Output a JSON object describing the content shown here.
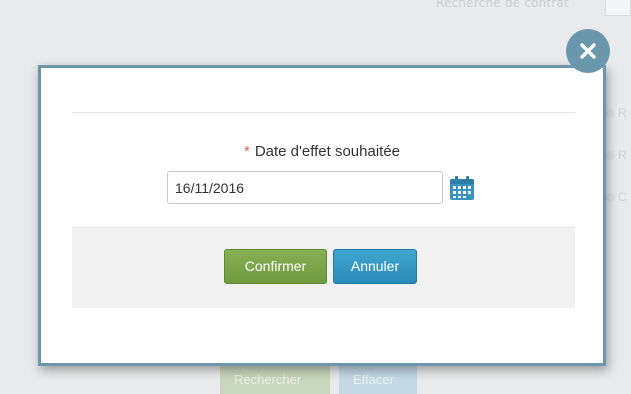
{
  "background": {
    "header_text": "Recherche de contrat",
    "side_labels": [
      "R",
      "R",
      "C"
    ],
    "search_button": "Rechercher",
    "clear_button": "Effacer"
  },
  "modal": {
    "field_label": "Date d'effet souhaitée",
    "required_marker": "*",
    "date_value": "16/11/2016",
    "confirm_label": "Confirmer",
    "cancel_label": "Annuler",
    "close_icon": "close-icon",
    "calendar_icon": "calendar-icon"
  },
  "colors": {
    "accent": "#6a97ab",
    "confirm": "#709a3e",
    "cancel": "#2a8bb8",
    "required": "#e35d6a"
  }
}
